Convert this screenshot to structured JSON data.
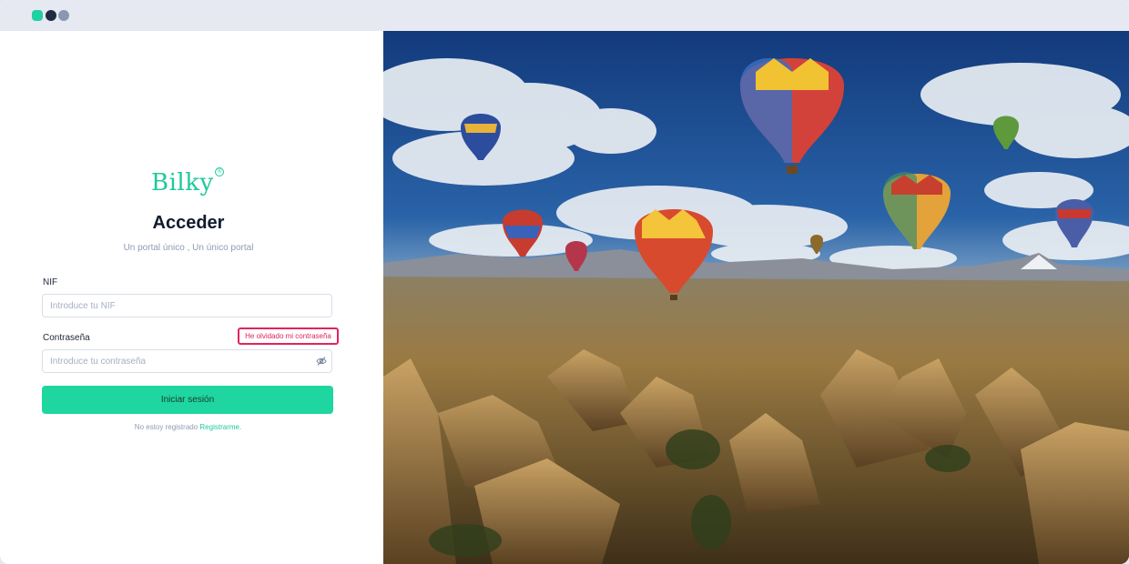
{
  "window": {
    "dots": [
      "#1fd1a0",
      "#1e2b45",
      "#8a97b0"
    ]
  },
  "brand": {
    "logo_text": "Bilky",
    "logo_mark": "®",
    "accent_color": "#1fc99b"
  },
  "login": {
    "title": "Acceder",
    "subtitle": "Un portal único , Un único portal",
    "nif": {
      "label": "NIF",
      "placeholder": "Introduce tu NIF",
      "value": ""
    },
    "password": {
      "label": "Contraseña",
      "placeholder": "Introduce tu contraseña",
      "value": "",
      "visibility_icon": "eye-off-icon"
    },
    "forgot_label": "He olvidado mi contraseña",
    "submit_label": "Iniciar sesión",
    "register_prompt": "No estoy registrado",
    "register_link": "Registrarme."
  },
  "hero": {
    "image": "hot-air-balloons-landscape"
  }
}
